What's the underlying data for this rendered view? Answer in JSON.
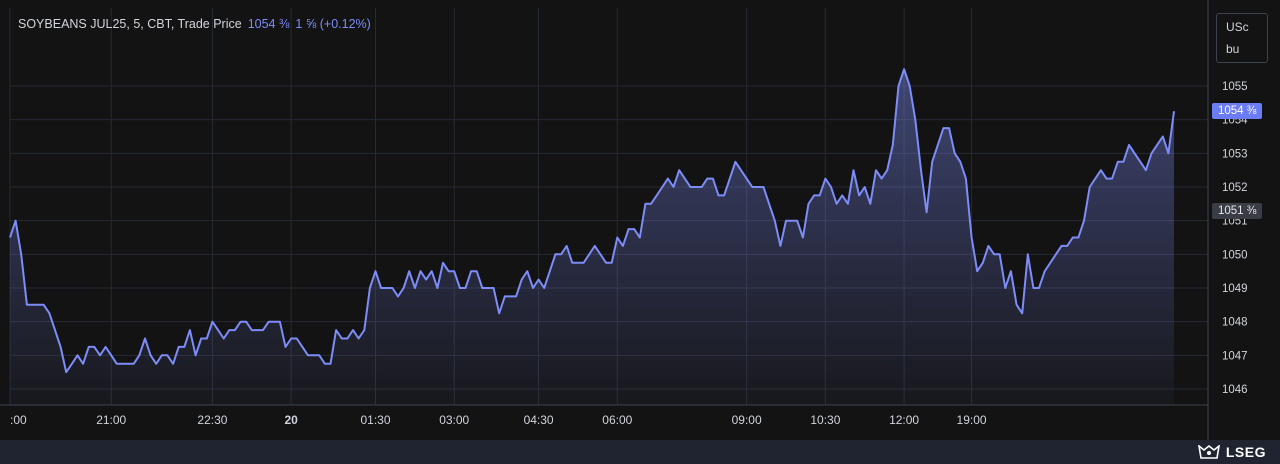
{
  "legend": {
    "instrument": "SOYBEANS JUL25, 5, CBT, Trade Price",
    "last": "1054 ⅜",
    "change": "1 ⅝ (+0.12%)"
  },
  "unit": {
    "line1": "USc",
    "line2": "bu"
  },
  "tags": {
    "last": "1054 ⅜",
    "previous_close": "1051 ⅜"
  },
  "brand": {
    "name": "LSEG"
  },
  "colors": {
    "background": "#131313",
    "line": "#7d8cf7",
    "grid": "#262a33",
    "tag_last": "#6b7cf5",
    "tag_prev": "#3a3d46"
  },
  "chart_data": {
    "type": "area",
    "title": "SOYBEANS JUL25, 5, CBT, Trade Price",
    "xlabel": "",
    "ylabel": "USc bu",
    "ylim": [
      1045.5,
      1056.4
    ],
    "yticks": [
      1046,
      1047,
      1048,
      1049,
      1050,
      1051,
      1052,
      1053,
      1054,
      1055
    ],
    "xticks": [
      {
        "label": ":00",
        "index": 0
      },
      {
        "label": "21:00",
        "index": 18
      },
      {
        "label": "22:30",
        "index": 36
      },
      {
        "label": "20",
        "index": 50,
        "bold": true
      },
      {
        "label": "01:30",
        "index": 65
      },
      {
        "label": "03:00",
        "index": 79
      },
      {
        "label": "04:30",
        "index": 94
      },
      {
        "label": "06:00",
        "index": 108
      },
      {
        "label": "09:00",
        "index": 131
      },
      {
        "label": "10:30",
        "index": 145
      },
      {
        "label": "12:00",
        "index": 159
      },
      {
        "label": "19:00",
        "index": 171
      }
    ],
    "grid": true,
    "series": [
      {
        "values": [
          1050.5,
          1051,
          1050,
          1048.5,
          1048.5,
          1048.5,
          1048.5,
          1048.25,
          1047.75,
          1047.25,
          1046.5,
          1046.75,
          1047,
          1046.75,
          1047.25,
          1047.25,
          1047,
          1047.25,
          1047,
          1046.75,
          1046.75,
          1046.75,
          1046.75,
          1047,
          1047.5,
          1047,
          1046.75,
          1047,
          1047,
          1046.75,
          1047.25,
          1047.25,
          1047.75,
          1047,
          1047.5,
          1047.5,
          1048,
          1047.75,
          1047.5,
          1047.75,
          1047.75,
          1048,
          1048,
          1047.75,
          1047.75,
          1047.75,
          1048,
          1048,
          1048,
          1047.25,
          1047.5,
          1047.5,
          1047.25,
          1047,
          1047,
          1047,
          1046.75,
          1046.75,
          1047.75,
          1047.5,
          1047.5,
          1047.75,
          1047.5,
          1047.75,
          1049,
          1049.5,
          1049,
          1049,
          1049,
          1048.75,
          1049,
          1049.5,
          1049,
          1049.5,
          1049.25,
          1049.5,
          1049,
          1049.75,
          1049.5,
          1049.5,
          1049,
          1049,
          1049.5,
          1049.5,
          1049,
          1049,
          1049,
          1048.25,
          1048.75,
          1048.75,
          1048.75,
          1049.25,
          1049.5,
          1049,
          1049.25,
          1049,
          1049.5,
          1050,
          1050,
          1050.25,
          1049.75,
          1049.75,
          1049.75,
          1050,
          1050.25,
          1050,
          1049.75,
          1049.75,
          1050.5,
          1050.25,
          1050.75,
          1050.75,
          1050.5,
          1051.5,
          1051.5,
          1051.75,
          1052,
          1052.25,
          1052,
          1052.5,
          1052.25,
          1052,
          1052,
          1052,
          1052.25,
          1052.25,
          1051.75,
          1051.75,
          1052.25,
          1052.75,
          1052.5,
          1052.25,
          1052,
          1052,
          1052,
          1051.5,
          1051,
          1050.25,
          1051,
          1051,
          1051,
          1050.5,
          1051.5,
          1051.75,
          1051.75,
          1052.25,
          1052,
          1051.5,
          1051.75,
          1051.5,
          1052.5,
          1051.75,
          1052,
          1051.5,
          1052.5,
          1052.25,
          1052.5,
          1053.25,
          1055,
          1055.5,
          1055,
          1054,
          1052.5,
          1051.25,
          1052.75,
          1053.25,
          1053.75,
          1053.75,
          1053,
          1052.75,
          1052.25,
          1050.5,
          1049.5,
          1049.75,
          1050.25,
          1050,
          1050,
          1049,
          1049.5,
          1048.5,
          1048.25,
          1050,
          1049,
          1049,
          1049.5,
          1049.75,
          1050,
          1050.25,
          1050.25,
          1050.5,
          1050.5,
          1051,
          1052,
          1052.25,
          1052.5,
          1052.25,
          1052.25,
          1052.75,
          1052.75,
          1053.25,
          1053,
          1052.75,
          1052.5,
          1053,
          1053.25,
          1053.5,
          1053,
          1054.25
        ]
      }
    ]
  }
}
